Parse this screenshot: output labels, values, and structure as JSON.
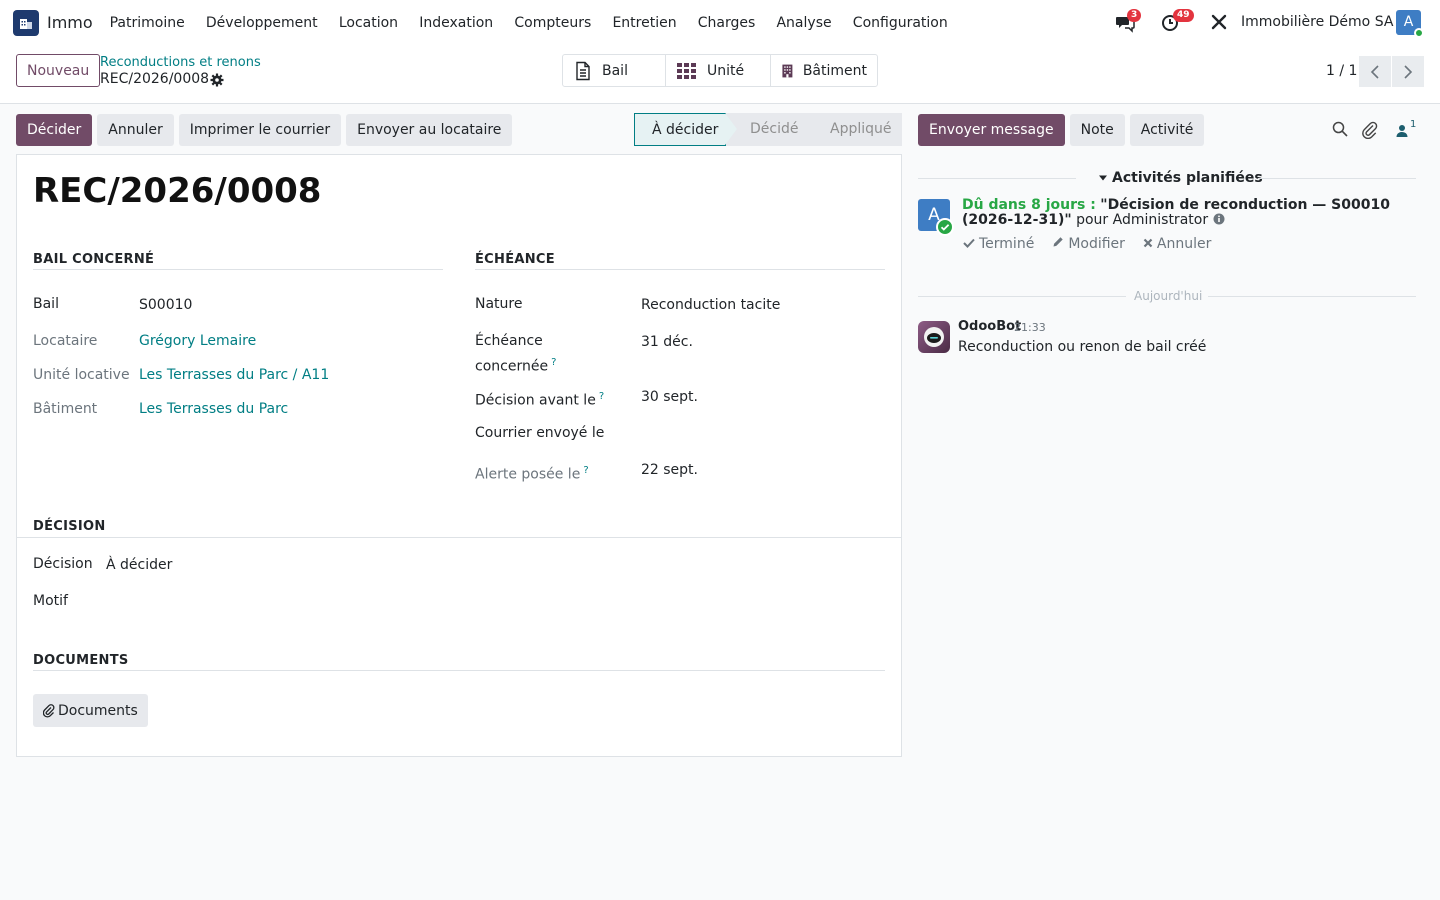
{
  "app": {
    "name": "Immo"
  },
  "menu": [
    "Patrimoine",
    "Développement",
    "Location",
    "Indexation",
    "Compteurs",
    "Entretien",
    "Charges",
    "Analyse",
    "Configuration"
  ],
  "systray": {
    "messages_count": "3",
    "activities_count": "49",
    "company": "Immobilière Démo SA",
    "user_initial": "A"
  },
  "control": {
    "new_label": "Nouveau",
    "breadcrumb": "Reconductions et renons",
    "record": "REC/2026/0008",
    "smart_buttons": {
      "bail": "Bail",
      "unite": "Unité",
      "batiment": "Bâtiment"
    },
    "pager": "1 / 1"
  },
  "actions": {
    "decider": "Décider",
    "annuler": "Annuler",
    "imprimer": "Imprimer le courrier",
    "envoyer": "Envoyer au locataire"
  },
  "status": {
    "steps": [
      "À décider",
      "Décidé",
      "Appliqué"
    ],
    "active": "À décider"
  },
  "form": {
    "title": "REC/2026/0008",
    "sections": {
      "bail": "BAIL CONCERNÉ",
      "echeance": "ÉCHÉANCE",
      "decision": "DÉCISION",
      "documents": "DOCUMENTS"
    },
    "bail": {
      "label": "Bail",
      "value": "S00010"
    },
    "locataire": {
      "label": "Locataire",
      "value": "Grégory Lemaire"
    },
    "unite": {
      "label": "Unité locative",
      "value": "Les Terrasses du Parc / A11"
    },
    "batiment": {
      "label": "Bâtiment",
      "value": "Les Terrasses du Parc"
    },
    "nature": {
      "label": "Nature",
      "value": "Reconduction tacite"
    },
    "echeance_concernee": {
      "label1": "Échéance",
      "label2": "concernée",
      "value": "31 déc."
    },
    "decision_avant": {
      "label": "Décision avant le",
      "value": "30 sept."
    },
    "courrier": {
      "label": "Courrier envoyé le",
      "value": ""
    },
    "alerte": {
      "label": "Alerte posée le",
      "value": "22 sept."
    },
    "decision": {
      "label": "Décision",
      "value": "À décider"
    },
    "motif": {
      "label": "Motif",
      "value": ""
    },
    "help_mark": "?",
    "documents_button": "Documents"
  },
  "chatter": {
    "send_message": "Envoyer message",
    "note": "Note",
    "activity": "Activité",
    "followers_count": "1",
    "planned_title": "Activités planifiées",
    "activity_item": {
      "avatar": "A",
      "due": "Dû dans 8 jours :",
      "summary": "\"Décision de reconduction — S00010 (2026-12-31)\"",
      "for": "pour Administrator",
      "done": "Terminé",
      "edit": "Modifier",
      "cancel": "Annuler"
    },
    "date_separator": "Aujourd'hui",
    "message": {
      "author": "OdooBot",
      "time": "21:33",
      "body": "Reconduction ou renon de bail créé"
    }
  }
}
